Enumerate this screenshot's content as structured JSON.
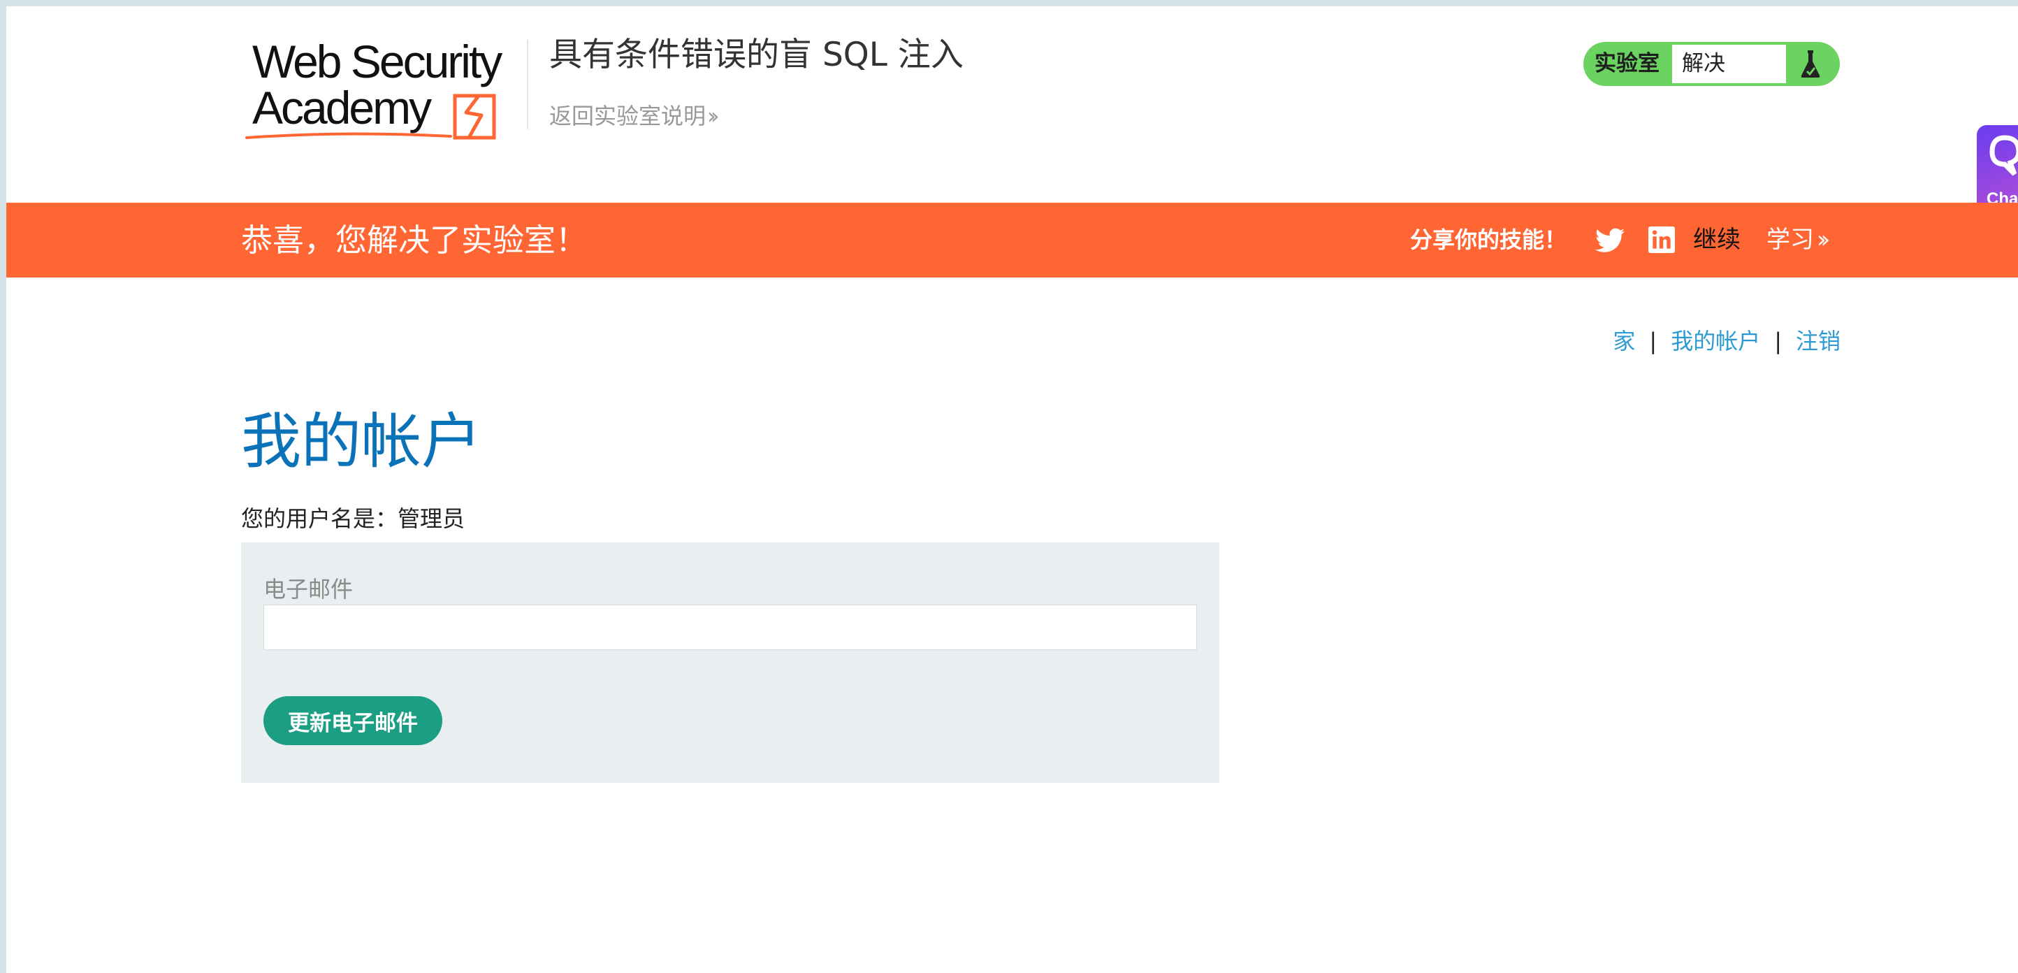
{
  "header": {
    "logo_line1": "Web Security",
    "logo_line2": "Academy",
    "lab_title": "具有条件错误的盲 SQL 注入",
    "back_link": "返回实验室说明",
    "status_label": "实验室",
    "status_value": "解决",
    "chat_label": "Chat"
  },
  "banner": {
    "message": "恭喜，您解决了实验室！",
    "share_label": "分享你的技能！",
    "continue_label": "继续",
    "learn_label": "学习"
  },
  "nav": {
    "home": "家",
    "separator": "|",
    "my_account": "我的帐户",
    "logout": "注销"
  },
  "main": {
    "title": "我的帐户",
    "username_line": "您的用户名是：管理员",
    "email_label": "电子邮件",
    "email_value": "",
    "update_button": "更新电子邮件"
  },
  "colors": {
    "banner": "#ff6633",
    "status_green": "#6bd35f",
    "title_blue": "#0a72b8",
    "link_blue": "#2d9bd1",
    "button_green": "#1b9e83",
    "panel_bg": "#e9eef0"
  },
  "icons": {
    "flask": "flask-icon",
    "twitter": "twitter-icon",
    "linkedin": "linkedin-icon",
    "chat": "chat-icon"
  }
}
